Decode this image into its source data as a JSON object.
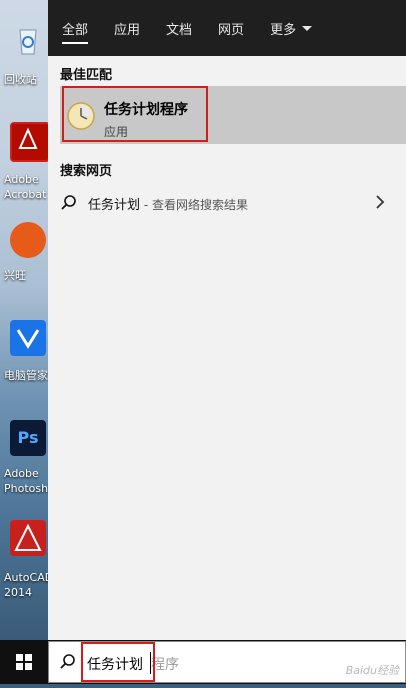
{
  "tabs": [
    {
      "label": "全部",
      "active": true
    },
    {
      "label": "应用"
    },
    {
      "label": "文档"
    },
    {
      "label": "网页"
    },
    {
      "label": "更多"
    }
  ],
  "best_match": {
    "section_title": "最佳匹配",
    "name": "任务计划程序",
    "type": "应用",
    "icon": "task-scheduler-icon"
  },
  "web_search": {
    "section_title": "搜索网页",
    "query": "任务计划",
    "hint": " - 查看网络搜索结果",
    "icon": "search-icon"
  },
  "desktop_icons": [
    {
      "label": "回收站",
      "icon": "recycle-bin-icon"
    },
    {
      "label": "Adobe Acrobat",
      "icon": "acrobat-icon"
    },
    {
      "label": "兴旺",
      "icon": "app-icon"
    },
    {
      "label": "电脑管家",
      "icon": "pc-manager-icon"
    },
    {
      "label": "Adobe Photoshop",
      "icon": "photoshop-icon"
    },
    {
      "label": "AutoCAD 2014",
      "icon": "autocad-icon"
    }
  ],
  "search_box": {
    "typed": "任务计划",
    "suggestion": "程序"
  },
  "watermark": "Baidu经验",
  "colors": {
    "highlight": "#d0201c",
    "topbar": "#1f1f1f",
    "selected": "#c8c8c8"
  }
}
